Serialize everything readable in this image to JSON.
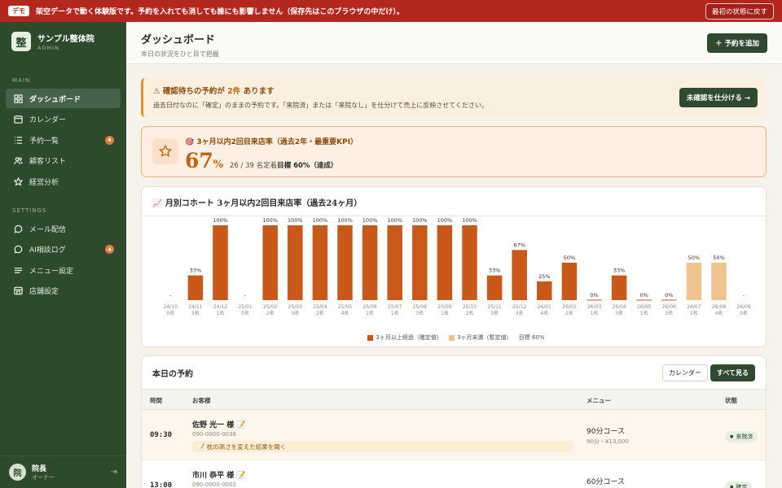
{
  "demo_banner": {
    "tag": "デモ",
    "text": "架空データで動く体験版です。予約を入れても消しても誰にも影響しません（保存先はこのブラウザの中だけ）。",
    "reset_label": "最初の状態に戻す"
  },
  "brand": {
    "logo": "整",
    "name": "サンプル整体院",
    "sub": "ADMIN"
  },
  "sidebar": {
    "main_section": "MAIN",
    "main_items": [
      {
        "label": "ダッシュボード",
        "icon": "grid-icon",
        "active": true,
        "badge": ""
      },
      {
        "label": "カレンダー",
        "icon": "calendar-icon",
        "active": false,
        "badge": ""
      },
      {
        "label": "予約一覧",
        "icon": "list-icon",
        "active": false,
        "badge": "4"
      },
      {
        "label": "顧客リスト",
        "icon": "users-icon",
        "active": false,
        "badge": ""
      },
      {
        "label": "経営分析",
        "icon": "star-icon",
        "active": false,
        "badge": ""
      }
    ],
    "settings_section": "SETTINGS",
    "settings_items": [
      {
        "label": "メール配信",
        "icon": "chat-icon",
        "badge": ""
      },
      {
        "label": "AI相談ログ",
        "icon": "chat-icon",
        "badge": "4"
      },
      {
        "label": "メニュー設定",
        "icon": "menu-icon",
        "badge": ""
      },
      {
        "label": "店舗設定",
        "icon": "store-icon",
        "badge": ""
      }
    ],
    "user": {
      "avatar": "院",
      "name": "院長",
      "role": "オーナー"
    }
  },
  "header": {
    "title": "ダッシュボード",
    "subtitle": "本日の状況をひと目で把握",
    "add_label": "＋ 予約を追加"
  },
  "alert": {
    "title_prefix": "⚠ 確認待ちの予約が",
    "title_count": "2件",
    "title_suffix": "あります",
    "desc": "過去日付なのに「確定」のままの予約です。「来院済」または「来院なし」を仕分けて売上に反映させてください。",
    "button": "未確認を仕分ける →"
  },
  "kpi": {
    "title": "🎯 3ヶ月以内2回目来店率（過去2年・最重要KPI）",
    "value": "67",
    "unit": "%",
    "detail_prefix": "26 / 39 名定着",
    "detail_goal": "目標 60%（達成）"
  },
  "chart_data": {
    "type": "bar",
    "title": "📈 月別コホート 3ヶ月以内2回目来店率（過去24ヶ月）",
    "categories": [
      "24/10",
      "24/11",
      "24/12",
      "25/01",
      "25/02",
      "25/03",
      "25/04",
      "25/05",
      "25/06",
      "25/07",
      "25/08",
      "25/09",
      "25/10",
      "25/11",
      "25/12",
      "26/01",
      "26/02",
      "26/03",
      "26/04",
      "26/05",
      "26/06",
      "26/07",
      "26/08",
      "26/09"
    ],
    "counts": [
      "0名",
      "3名",
      "1名",
      "0名",
      "2名",
      "3名",
      "2名",
      "4名",
      "1名",
      "1名",
      "3名",
      "1名",
      "2名",
      "3名",
      "3名",
      "4名",
      "2名",
      "1名",
      "3名",
      "1名",
      "3名",
      "2名",
      "4名",
      "0名"
    ],
    "values": [
      null,
      33,
      100,
      null,
      100,
      100,
      100,
      100,
      100,
      100,
      100,
      100,
      100,
      33,
      67,
      25,
      50,
      0,
      33,
      0,
      0,
      50,
      50,
      null
    ],
    "labels": [
      "-",
      "33%",
      "100%",
      "-",
      "100%",
      "100%",
      "100%",
      "100%",
      "100%",
      "100%",
      "100%",
      "100%",
      "100%",
      "33%",
      "67%",
      "25%",
      "50%",
      "0%",
      "33%",
      "0%",
      "0%",
      "50%",
      "50%",
      "-"
    ],
    "provisional": [
      false,
      false,
      false,
      false,
      false,
      false,
      false,
      false,
      false,
      false,
      false,
      false,
      false,
      false,
      false,
      false,
      false,
      false,
      false,
      false,
      false,
      true,
      true,
      false
    ],
    "ylim": [
      0,
      100
    ],
    "colors": {
      "confirmed": "#c9591a",
      "provisional": "#efc38e"
    },
    "legend": {
      "confirmed": "3ヶ月以上経過（確定値）",
      "provisional": "3ヶ月未満（暫定値）",
      "target": "目標 60%"
    }
  },
  "today": {
    "title": "本日の予約",
    "calendar_label": "カレンダー",
    "all_label": "すべて見る",
    "columns": {
      "time": "時間",
      "customer": "お客様",
      "menu": "メニュー",
      "status": "状態"
    },
    "rows": [
      {
        "time": "09:30",
        "name": "佐野 光一 様 📝",
        "tel": "090-0000-0036",
        "note": "📝 枕の高さを変えた結果を聞く",
        "menu": "90分コース",
        "menu_sub": "90分・¥13,000",
        "status": "来院済"
      },
      {
        "time": "13:00",
        "name": "市川 恭平 様 📝",
        "tel": "090-0000-0002",
        "note": "",
        "menu": "60分コース",
        "menu_sub": "",
        "status": "確定"
      }
    ]
  }
}
